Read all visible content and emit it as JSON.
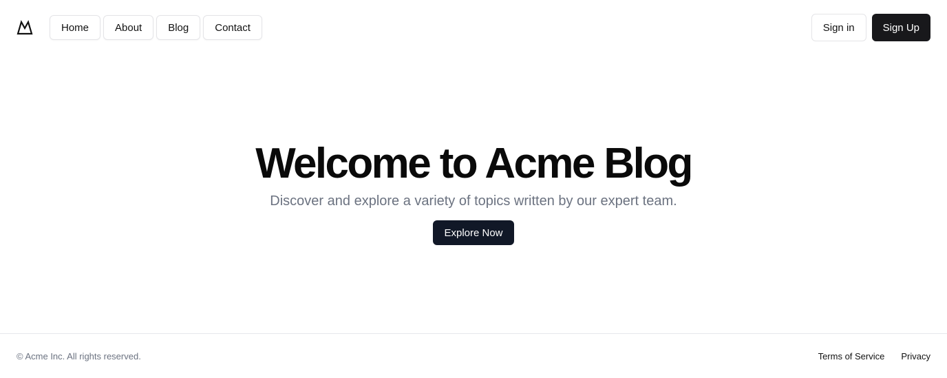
{
  "header": {
    "logo_icon": "mountain-icon",
    "nav": [
      {
        "label": "Home"
      },
      {
        "label": "About"
      },
      {
        "label": "Blog"
      },
      {
        "label": "Contact"
      }
    ],
    "sign_in_label": "Sign in",
    "sign_up_label": "Sign Up"
  },
  "hero": {
    "title": "Welcome to Acme Blog",
    "subtitle": "Discover and explore a variety of topics written by our expert team.",
    "cta_label": "Explore Now"
  },
  "footer": {
    "copyright": "© Acme Inc. All rights reserved.",
    "links": [
      {
        "label": "Terms of Service"
      },
      {
        "label": "Privacy"
      }
    ]
  },
  "colors": {
    "primary_button": "#18181b",
    "cta_button": "#111827",
    "muted_text": "#6b7280",
    "border": "#e4e4e7"
  }
}
